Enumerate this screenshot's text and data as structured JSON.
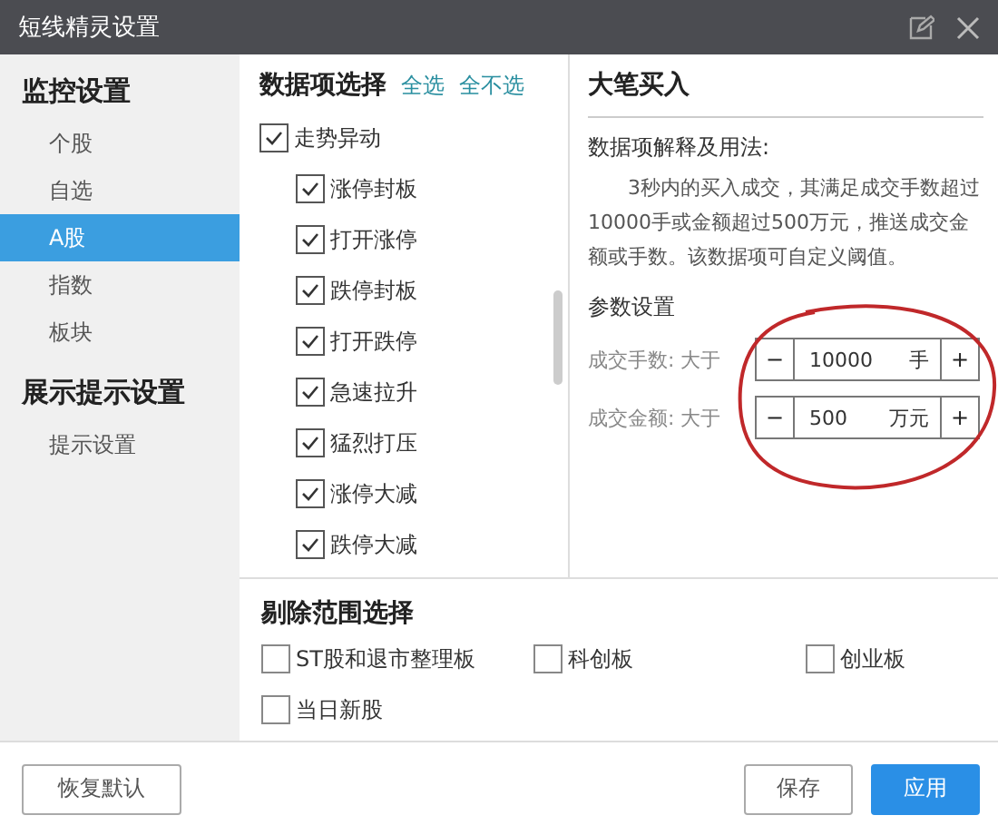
{
  "window": {
    "title": "短线精灵设置"
  },
  "sidebar": {
    "sections": [
      {
        "heading": "监控设置",
        "items": [
          {
            "label": "个股",
            "selected": false
          },
          {
            "label": "自选",
            "selected": false
          },
          {
            "label": "A股",
            "selected": true
          },
          {
            "label": "指数",
            "selected": false
          },
          {
            "label": "板块",
            "selected": false
          }
        ]
      },
      {
        "heading": "展示提示设置",
        "items": [
          {
            "label": "提示设置",
            "selected": false
          }
        ]
      }
    ]
  },
  "data_items": {
    "title": "数据项选择",
    "select_all": "全选",
    "select_none": "全不选",
    "tree": [
      {
        "label": "走势异动",
        "checked": true,
        "children": [
          {
            "label": "涨停封板",
            "checked": true
          },
          {
            "label": "打开涨停",
            "checked": true
          },
          {
            "label": "跌停封板",
            "checked": true
          },
          {
            "label": "打开跌停",
            "checked": true
          },
          {
            "label": "急速拉升",
            "checked": true
          },
          {
            "label": "猛烈打压",
            "checked": true
          },
          {
            "label": "涨停大减",
            "checked": true
          },
          {
            "label": "跌停大减",
            "checked": true
          }
        ]
      }
    ]
  },
  "detail": {
    "title": "大笔买入",
    "usage_heading": "数据项解释及用法:",
    "usage_text": "3秒内的买入成交，其满足成交手数超过10000手或金额超过500万元，推送成交金额或手数。该数据项可自定义阈值。",
    "params_heading": "参数设置",
    "params": [
      {
        "label": "成交手数: 大于",
        "minus": "−",
        "value": "10000",
        "unit": "手",
        "plus": "+"
      },
      {
        "label": "成交金额: 大于",
        "minus": "−",
        "value": "500",
        "unit": "万元",
        "plus": "+"
      }
    ]
  },
  "exclude": {
    "title": "剔除范围选择",
    "options": [
      {
        "label": "ST股和退市整理板",
        "checked": false
      },
      {
        "label": "科创板",
        "checked": false
      },
      {
        "label": "创业板",
        "checked": false
      },
      {
        "label": "当日新股",
        "checked": false
      }
    ]
  },
  "footer": {
    "buttons": [
      {
        "label": "恢复默认",
        "kind": "plain"
      },
      {
        "label": "保存",
        "kind": "plain"
      },
      {
        "label": "应用",
        "kind": "primary"
      }
    ]
  }
}
